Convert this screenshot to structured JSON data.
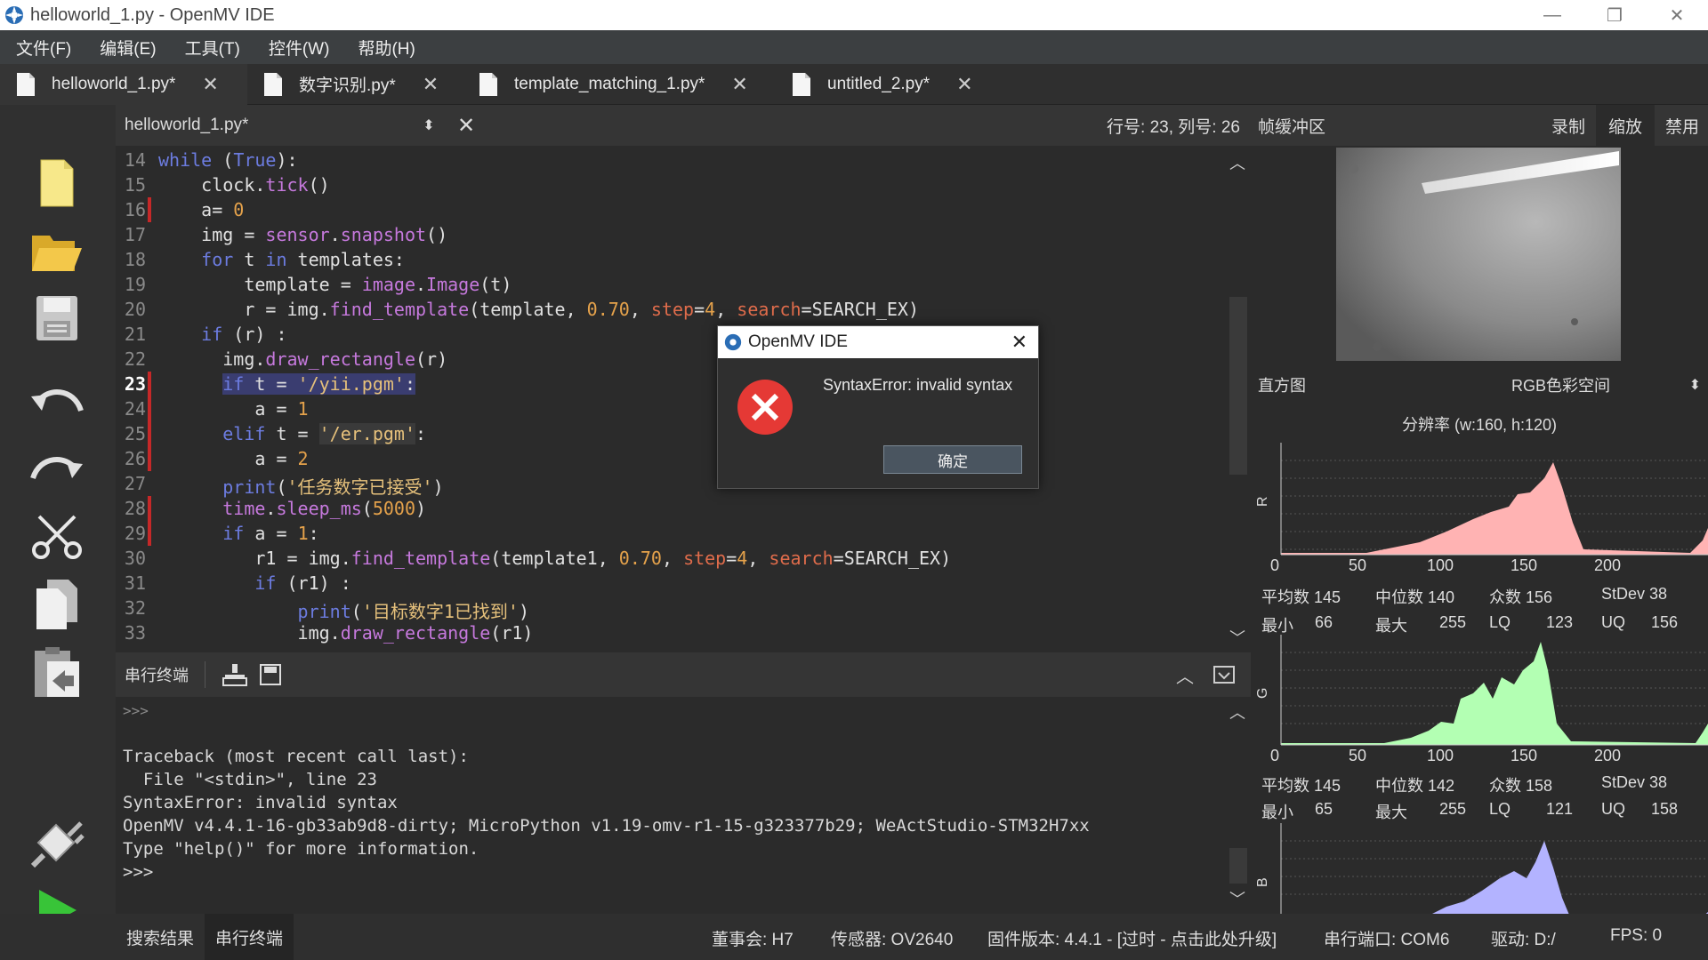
{
  "window": {
    "title": "helloworld_1.py - OpenMV IDE",
    "minimize": "—",
    "restore": "❐",
    "close": "✕"
  },
  "menu": [
    "文件(F)",
    "编辑(E)",
    "工具(T)",
    "控件(W)",
    "帮助(H)"
  ],
  "tabs": [
    {
      "label": "helloworld_1.py*"
    },
    {
      "label": "数字识别.py*"
    },
    {
      "label": "template_matching_1.py*"
    },
    {
      "label": "untitled_2.py*"
    }
  ],
  "editor": {
    "filename": "helloworld_1.py*",
    "position": "行号: 23, 列号: 26",
    "lines": [
      {
        "n": "14"
      },
      {
        "n": "15"
      },
      {
        "n": "16"
      },
      {
        "n": "17"
      },
      {
        "n": "18"
      },
      {
        "n": "19"
      },
      {
        "n": "20"
      },
      {
        "n": "21"
      },
      {
        "n": "22"
      },
      {
        "n": "23"
      },
      {
        "n": "24"
      },
      {
        "n": "25"
      },
      {
        "n": "26"
      },
      {
        "n": "27"
      },
      {
        "n": "28"
      },
      {
        "n": "29"
      },
      {
        "n": "30"
      },
      {
        "n": "31"
      },
      {
        "n": "32"
      },
      {
        "n": "33"
      }
    ]
  },
  "dialog": {
    "title": "OpenMV IDE",
    "message": "SyntaxError: invalid syntax",
    "ok": "确定"
  },
  "serial": {
    "label": "串行终端",
    "lines": [
      ">>>",
      "",
      "Traceback (most recent call last):",
      "  File \"<stdin>\", line 23",
      "SyntaxError: invalid syntax",
      "OpenMV v4.4.1-16-gb33ab9d8-dirty; MicroPython v1.19-omv-r1-15-g323377b29; WeActStudio-STM32H7xx",
      "Type \"help()\" for more information.",
      ">>>"
    ]
  },
  "framebuffer": {
    "label": "帧缓冲区",
    "record": "录制",
    "zoom": "缩放",
    "disable": "禁用"
  },
  "histogram": {
    "label": "直方图",
    "colorspace": "RGB色彩空间",
    "resolution": "分辨率 (w:160, h:120)",
    "ticks": [
      "0",
      "50",
      "100",
      "150",
      "200"
    ],
    "channels": [
      {
        "name": "R",
        "color": "#ffb3b3",
        "mean": "平均数 145",
        "median": "中位数 140",
        "mode": "众数 156",
        "stdev": "StDev 38",
        "min_label": "最小",
        "min": "66",
        "max_label": "最大",
        "max": "255",
        "lq_label": "LQ",
        "lq": "123",
        "uq_label": "UQ",
        "uq": "156"
      },
      {
        "name": "G",
        "color": "#b3ffb3",
        "mean": "平均数 145",
        "median": "中位数 142",
        "mode": "众数 158",
        "stdev": "StDev 38",
        "min_label": "最小",
        "min": "65",
        "max_label": "最大",
        "max": "255",
        "lq_label": "LQ",
        "lq": "121",
        "uq_label": "UQ",
        "uq": "158"
      },
      {
        "name": "B",
        "color": "#b3b3ff"
      }
    ]
  },
  "bottom": {
    "tab_search": "搜索结果",
    "tab_serial": "串行终端",
    "board": "董事会:  H7",
    "sensor": "传感器: OV2640",
    "firmware": "固件版本:  4.4.1 - [过时 - 点击此处升级]",
    "port": "串行端口:  COM6",
    "drive": "驱动:  D:/",
    "fps": "FPS:  0"
  },
  "colors": {
    "accent": "#6c7ce0",
    "error": "#e53935",
    "marker": "#c62828"
  }
}
